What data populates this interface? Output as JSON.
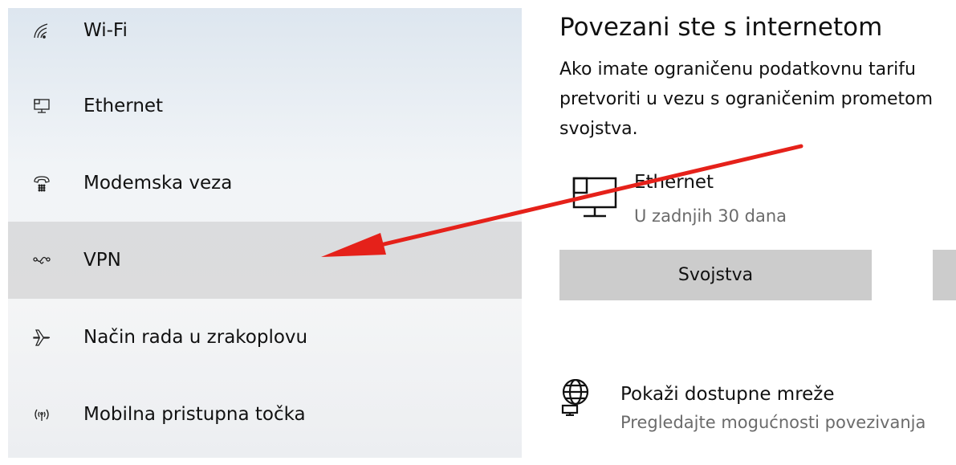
{
  "sidebar": {
    "items": [
      {
        "label": "Wi-Fi",
        "icon": "wifi-icon"
      },
      {
        "label": "Ethernet",
        "icon": "ethernet-icon"
      },
      {
        "label": "Modemska veza",
        "icon": "dialup-icon"
      },
      {
        "label": "VPN",
        "icon": "vpn-icon",
        "selected": true
      },
      {
        "label": "Način rada u zrakoplovu",
        "icon": "airplane-icon"
      },
      {
        "label": "Mobilna pristupna točka",
        "icon": "hotspot-icon"
      }
    ]
  },
  "main": {
    "title": "Povezani ste s internetom",
    "description_lines": [
      "Ako imate ograničenu podatkovnu tarifu",
      "pretvoriti u vezu s ograničenim prometom",
      "svojstva."
    ],
    "connection": {
      "name": "Ethernet",
      "status": "U zadnjih 30 dana",
      "icon": "ethernet-pc-icon"
    },
    "buttons": {
      "properties_label": "Svojstva",
      "second_label": ""
    },
    "networks": {
      "title": "Pokaži dostupne mreže",
      "subtitle": "Pregledajte mogućnosti povezivanja",
      "icon": "globe-network-icon"
    }
  },
  "colors": {
    "annotation_arrow": "#e5211a",
    "selected_item_bg": "#d6d6d6",
    "button_bg": "#cccccc",
    "secondary_text": "#6b6b6b"
  }
}
